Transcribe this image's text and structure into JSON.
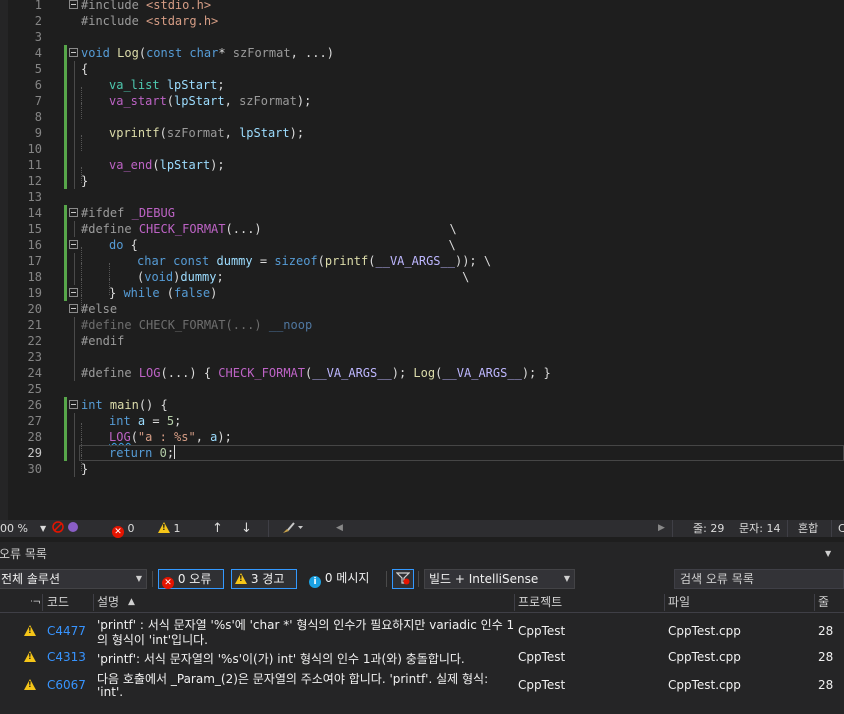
{
  "editor": {
    "lines": [
      {
        "n": "1",
        "html": "<span class='pp'>#include</span> <span class='str'>&lt;stdio.h&gt;</span>"
      },
      {
        "n": "2",
        "html": "<span class='pp'>#include</span> <span class='str'>&lt;stdarg.h&gt;</span>"
      },
      {
        "n": "3",
        "html": ""
      },
      {
        "n": "4",
        "html": "<span class='kw'>void</span> <span class='fn'>Log</span>(<span class='kw'>const</span> <span class='kw'>char</span>* <span class='par'>szFormat</span>, ...)"
      },
      {
        "n": "5",
        "html": "{"
      },
      {
        "n": "6",
        "html": "    <span class='ty'>va_list</span> <span class='var'>lpStart</span>;"
      },
      {
        "n": "7",
        "html": "    <span class='mac'>va_start</span>(<span class='var'>lpStart</span>, <span class='par'>szFormat</span>);"
      },
      {
        "n": "8",
        "html": ""
      },
      {
        "n": "9",
        "html": "    <span class='fn'>vprintf</span>(<span class='par'>szFormat</span>, <span class='var'>lpStart</span>);"
      },
      {
        "n": "10",
        "html": ""
      },
      {
        "n": "11",
        "html": "    <span class='mac'>va_end</span>(<span class='var'>lpStart</span>);"
      },
      {
        "n": "12",
        "html": "}"
      },
      {
        "n": "13",
        "html": ""
      },
      {
        "n": "14",
        "html": "<span class='pp'>#ifdef</span> <span class='mac'>_DEBUG</span>"
      },
      {
        "n": "15",
        "html": "<span class='pp'>#define</span> <span class='mac'>CHECK_FORMAT</span>(...)                          \\"
      },
      {
        "n": "16",
        "html": "    <span class='kw'>do</span> {                                           \\"
      },
      {
        "n": "17",
        "html": "        <span class='kw'>char</span> <span class='kw'>const</span> <span class='var'>dummy</span> = <span class='kw'>sizeof</span>(<span class='fn'>printf</span>(<span class='mac2'>__VA_ARGS__</span>)); \\"
      },
      {
        "n": "18",
        "html": "        (<span class='kw'>void</span>)<span class='var'>dummy</span>;                                 \\"
      },
      {
        "n": "19",
        "html": "    } <span class='kw'>while</span> (<span class='kw'>false</span>)"
      },
      {
        "n": "20",
        "html": "<span class='pp'>#else</span>"
      },
      {
        "n": "21",
        "html": "<span class='dim'>#define CHECK_FORMAT(...)</span> <span class='dimb'>__noop</span>"
      },
      {
        "n": "22",
        "html": "<span class='pp'>#endif</span>"
      },
      {
        "n": "23",
        "html": ""
      },
      {
        "n": "24",
        "html": "<span class='pp'>#define</span> <span class='mac'>LOG</span>(...) { <span class='mac'>CHECK_FORMAT</span>(<span class='mac2'>__VA_ARGS__</span>); <span class='fn'>Log</span>(<span class='mac2'>__VA_ARGS__</span>); }"
      },
      {
        "n": "25",
        "html": ""
      },
      {
        "n": "26",
        "html": "<span class='kw'>int</span> <span class='fn'>main</span>() {"
      },
      {
        "n": "27",
        "html": "    <span class='kw'>int</span> <span class='var'>a</span> = <span class='num'>5</span>;"
      },
      {
        "n": "28",
        "html": "    <span class='mac sq'>LOG</span>(<span class='str'>\"a : %s\"</span>, <span class='var'>a</span>);"
      },
      {
        "n": "29",
        "html": "    <span class='kw'>return</span> <span class='num'>0</span>;<span class='caret'></span>"
      },
      {
        "n": "30",
        "html": "}"
      }
    ]
  },
  "status": {
    "zoom": "00 %",
    "errors": "0",
    "warnings": "1",
    "line": "줄: 29",
    "col": "문자: 14",
    "mode": "혼합",
    "tail": "C"
  },
  "panel": {
    "title": "오류 목록",
    "scope": "전체 솔루션",
    "errors_btn": "0 오류",
    "warnings_btn": "3 경고",
    "messages_btn": "0 메시지",
    "build_filter": "빌드 + IntelliSense",
    "search_placeholder": "검색 오류 목록",
    "columns": {
      "code": "코드",
      "desc": "설명",
      "project": "프로젝트",
      "file": "파일",
      "line": "줄"
    },
    "rows": [
      {
        "code": "C4477",
        "desc1": "'printf' : 서식 문자열 '%s'에 'char *' 형식의 인수가 필요하지만 variadic 인수 1",
        "desc2": "의 형식이 'int'입니다.",
        "project": "CppTest",
        "file": "CppTest.cpp",
        "line": "28"
      },
      {
        "code": "C4313",
        "desc1": "'printf': 서식 문자열의 '%s'이(가) int' 형식의 인수 1과(와) 충돌합니다.",
        "desc2": "",
        "project": "CppTest",
        "file": "CppTest.cpp",
        "line": "28"
      },
      {
        "code": "C6067",
        "desc1": "다음 호출에서 _Param_(2)은 문자열의 주소여야 합니다. 'printf'. 실제 형식:",
        "desc2": "'int'.",
        "project": "CppTest",
        "file": "CppTest.cpp",
        "line": "28"
      }
    ]
  }
}
